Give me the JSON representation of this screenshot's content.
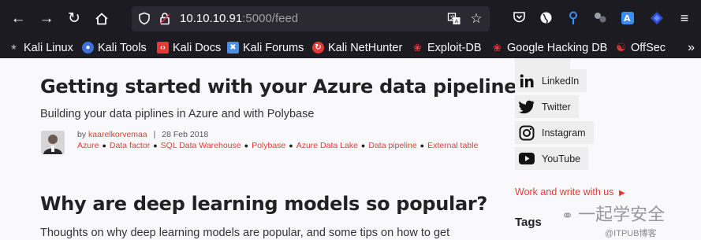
{
  "browser": {
    "url_host": "10.10.10.91",
    "url_path": ":5000/feed"
  },
  "bookmarks": [
    {
      "label": "Kali Linux",
      "color": "#367bf0"
    },
    {
      "label": "Kali Tools",
      "color": "#3f6fd8"
    },
    {
      "label": "Kali Docs",
      "color": "#e53935"
    },
    {
      "label": "Kali Forums",
      "color": "#4a90e2"
    },
    {
      "label": "Kali NetHunter",
      "color": "#e53935"
    },
    {
      "label": "Exploit-DB",
      "color": "#e57a3d"
    },
    {
      "label": "Google Hacking DB",
      "color": "#e57a3d"
    },
    {
      "label": "OffSec",
      "color": "#e53935"
    }
  ],
  "posts": [
    {
      "title": "Getting started with your Azure data pipeline",
      "subtitle": "Building your data piplines in Azure and with Polybase",
      "by": "by",
      "author": "kaarelkorvemaa",
      "divider": "|",
      "date": "28 Feb 2018",
      "tags": [
        "Azure",
        "Data factor",
        "SQL Data Warehouse",
        "Polybase",
        "Azure Data Lake",
        "Data pipeline",
        "External table"
      ]
    },
    {
      "title": "Why are deep learning models so popular?",
      "subtitle": "Thoughts on why deep learning models are popular, and some tips on how to get"
    }
  ],
  "sidebar": {
    "social": [
      {
        "label": "LinkedIn",
        "icon": "linkedin-icon"
      },
      {
        "label": "Twitter",
        "icon": "twitter-icon"
      },
      {
        "label": "Instagram",
        "icon": "instagram-icon"
      },
      {
        "label": "YouTube",
        "icon": "youtube-icon"
      }
    ],
    "work_link": "Work and write with us",
    "tags_heading": "Tags"
  },
  "watermark": {
    "main": "一起学安全",
    "sub": "@ITPUB博客"
  },
  "colors": {
    "accent": "#e53935",
    "chrome": "#1c1b22",
    "urlbar": "#2b2a33"
  }
}
